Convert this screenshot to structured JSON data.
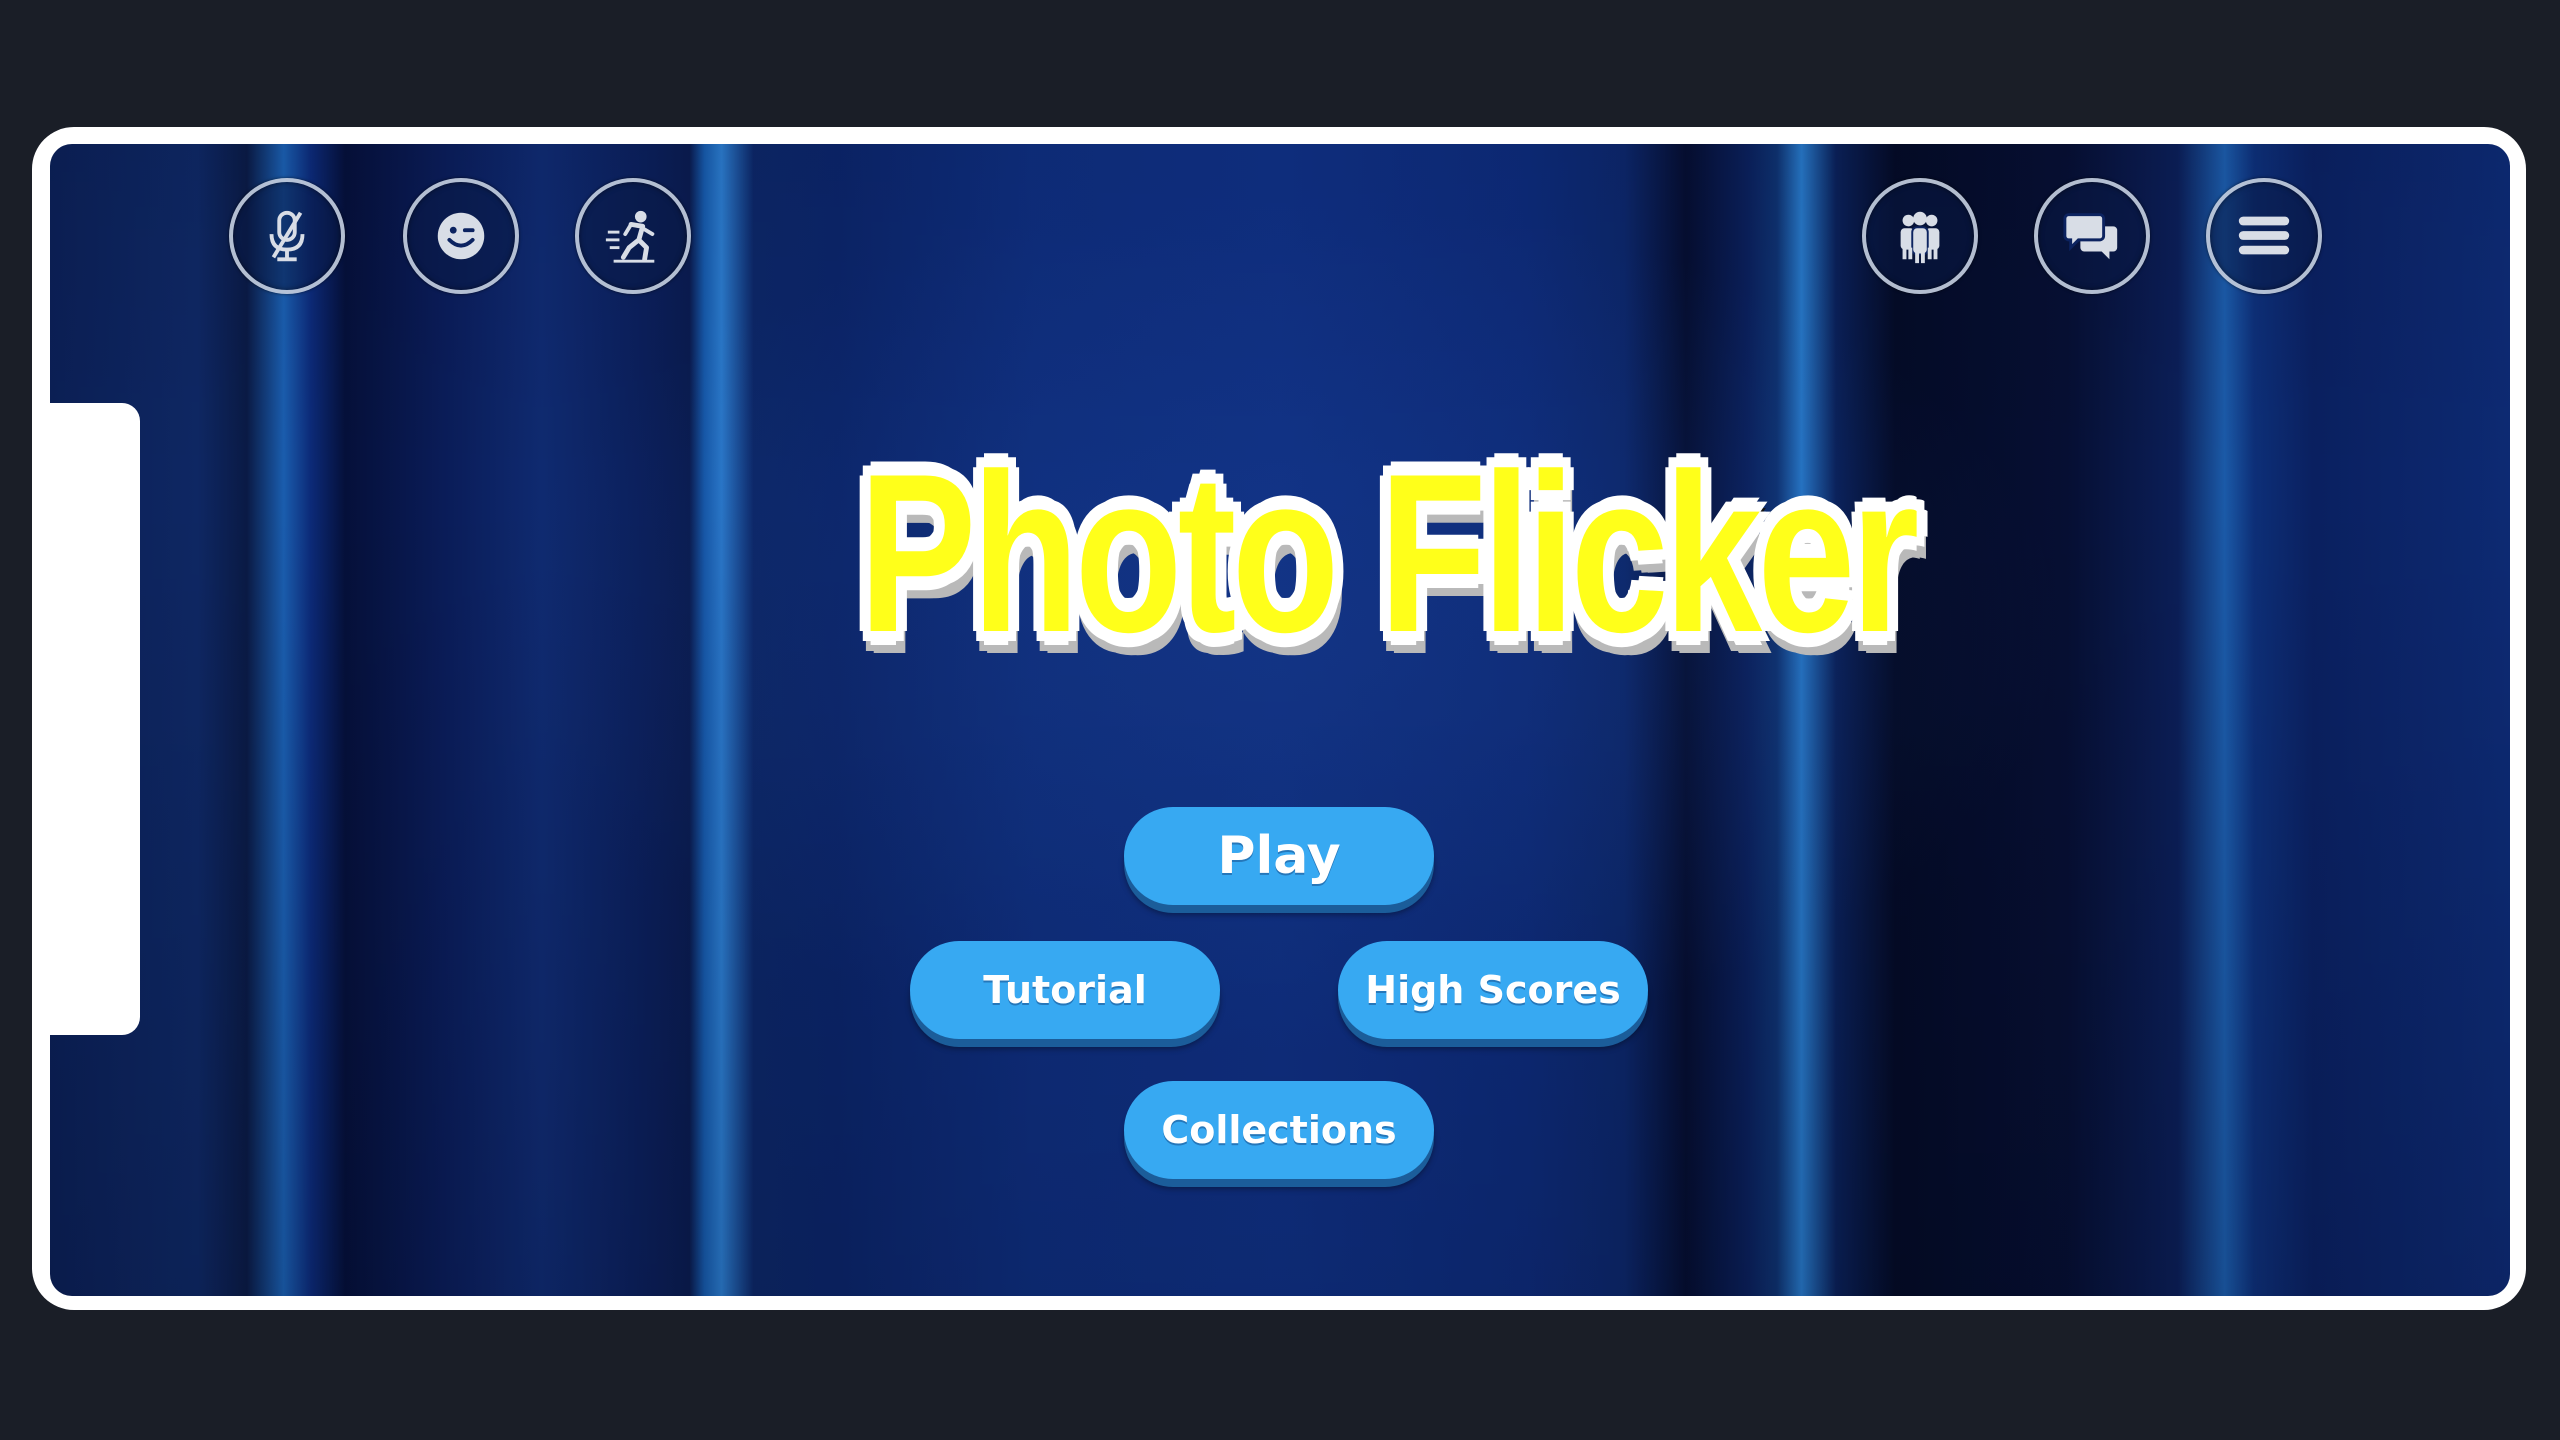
{
  "game": {
    "title": "Photo Flicker"
  },
  "menu": {
    "play_label": "Play",
    "tutorial_label": "Tutorial",
    "high_scores_label": "High Scores",
    "collections_label": "Collections"
  },
  "toolbar_left": [
    {
      "name": "mic-muted-icon"
    },
    {
      "name": "emoji-icon"
    },
    {
      "name": "running-person-icon"
    }
  ],
  "toolbar_right": [
    {
      "name": "people-icon"
    },
    {
      "name": "chat-icon"
    },
    {
      "name": "menu-icon"
    }
  ],
  "colors": {
    "title_fill": "#ffff1a",
    "button_fill": "#37a9f2",
    "background_dark": "#1a1e27"
  }
}
